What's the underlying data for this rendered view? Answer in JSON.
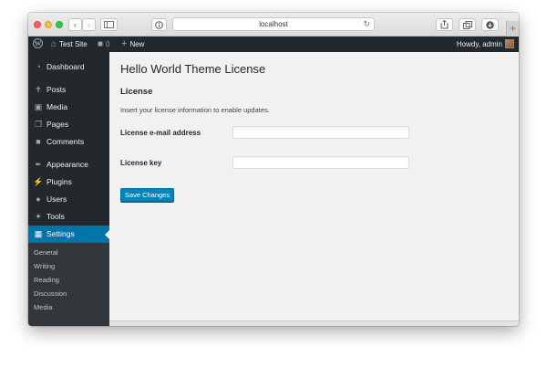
{
  "browser": {
    "url": "localhost",
    "icons": {
      "back": "chevron-left",
      "forward": "chevron-right",
      "sidebar": "sidebar",
      "privacy": "info-circle",
      "reload": "reload",
      "share": "share",
      "tabs": "tabs",
      "downloads": "download",
      "new_tab": "plus"
    }
  },
  "admin_bar": {
    "site_name": "Test Site",
    "comments_count": "0",
    "new_label": "New",
    "greeting": "Howdy, admin"
  },
  "sidebar": {
    "items": [
      {
        "label": "Dashboard",
        "icon": "dashboard-icon"
      },
      {
        "label": "Posts",
        "icon": "pin-icon"
      },
      {
        "label": "Media",
        "icon": "media-icon"
      },
      {
        "label": "Pages",
        "icon": "pages-icon"
      },
      {
        "label": "Comments",
        "icon": "comment-icon"
      },
      {
        "label": "Appearance",
        "icon": "brush-icon"
      },
      {
        "label": "Plugins",
        "icon": "plugin-icon"
      },
      {
        "label": "Users",
        "icon": "user-icon"
      },
      {
        "label": "Tools",
        "icon": "wrench-icon"
      },
      {
        "label": "Settings",
        "icon": "settings-icon"
      }
    ],
    "submenu": [
      "General",
      "Writing",
      "Reading",
      "Discussion",
      "Media"
    ]
  },
  "main": {
    "title": "Hello World Theme License",
    "section_title": "License",
    "description": "Insert your license information to enable updates.",
    "fields": [
      {
        "label": "License e-mail address",
        "value": ""
      },
      {
        "label": "License key",
        "value": ""
      }
    ],
    "save_label": "Save Changes"
  },
  "colors": {
    "admin_bar_bg": "#23282d",
    "accent": "#0073aa",
    "button": "#0085ba",
    "content_bg": "#f1f1f1"
  }
}
